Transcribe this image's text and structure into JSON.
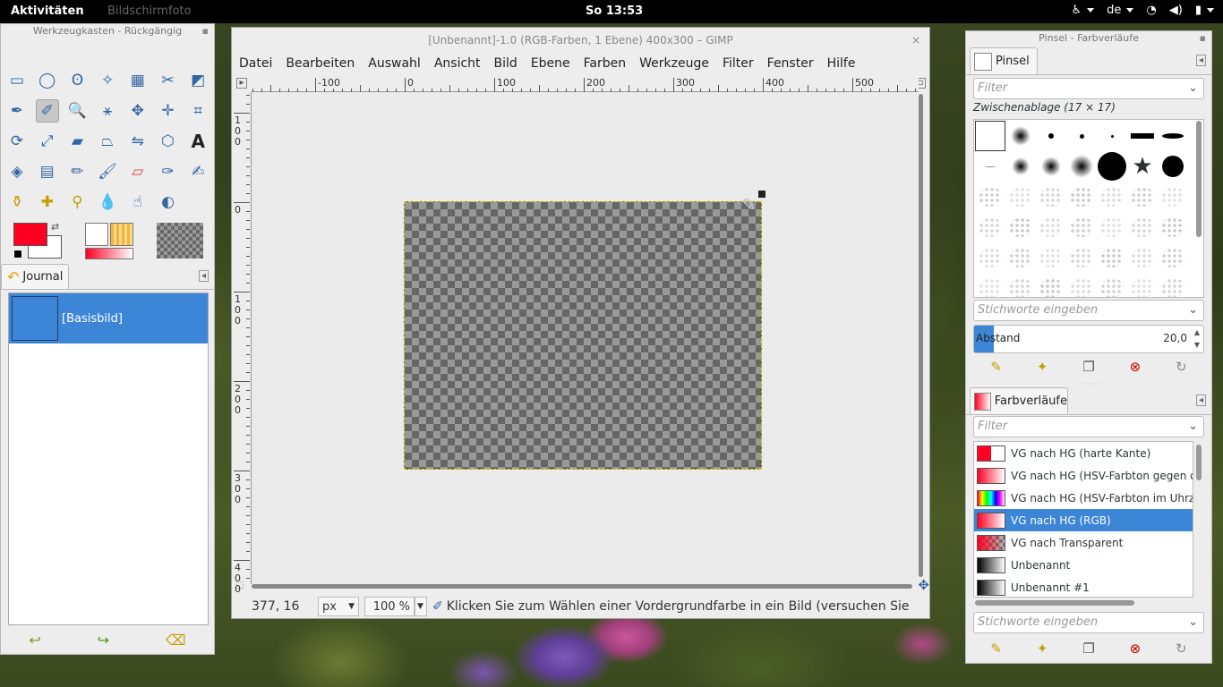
{
  "topbar": {
    "activities": "Aktivitäten",
    "app_menu": "Bildschirmfoto",
    "clock": "So 13:53",
    "keyboard_layout": "de",
    "icons": [
      "accessibility-icon",
      "network-icon",
      "volume-icon",
      "battery-icon"
    ]
  },
  "toolbox": {
    "title": "Werkzeugkasten - Rückgängig",
    "fg_color": "#ff0022",
    "bg_color": "#ffffff",
    "journal_tab": "Journal",
    "journal_items": [
      "[Basisbild]"
    ]
  },
  "image_window": {
    "title": "[Unbenannt]-1.0 (RGB-Farben, 1 Ebene) 400x300 – GIMP",
    "menu": [
      "Datei",
      "Bearbeiten",
      "Auswahl",
      "Ansicht",
      "Bild",
      "Ebene",
      "Farben",
      "Werkzeuge",
      "Filter",
      "Fenster",
      "Hilfe"
    ],
    "ruler_labels": [
      "-100",
      "0",
      "100",
      "200",
      "300",
      "400",
      "500"
    ],
    "vruler_labels": [
      "100",
      "0",
      "100",
      "200",
      "300",
      "400"
    ],
    "status": {
      "coords": "377, 16",
      "unit": "px",
      "zoom": "100 %",
      "message": "Klicken Sie zum Wählen einer Vordergrundfarbe in ein Bild (versuchen Sie Ums..."
    }
  },
  "dock": {
    "title": "Pinsel - Farbverläufe",
    "brushes_tab": "Pinsel",
    "filter_placeholder": "Filter",
    "brush_name": "Zwischenablage (17 × 17)",
    "tags_placeholder": "Stichworte eingeben",
    "spacing_label": "Abstand",
    "spacing_value": "20,0",
    "gradients_tab": "Farbverläufe",
    "gradients": [
      {
        "name": "VG nach HG (harte Kante)",
        "selected": false
      },
      {
        "name": "VG nach HG (HSV-Farbton gegen den U",
        "selected": false
      },
      {
        "name": "VG nach HG (HSV-Farbton im Uhrzeige",
        "selected": false
      },
      {
        "name": "VG nach HG (RGB)",
        "selected": true
      },
      {
        "name": "VG nach Transparent",
        "selected": false
      },
      {
        "name": "Unbenannt",
        "selected": false
      },
      {
        "name": "Unbenannt #1",
        "selected": false
      }
    ]
  }
}
